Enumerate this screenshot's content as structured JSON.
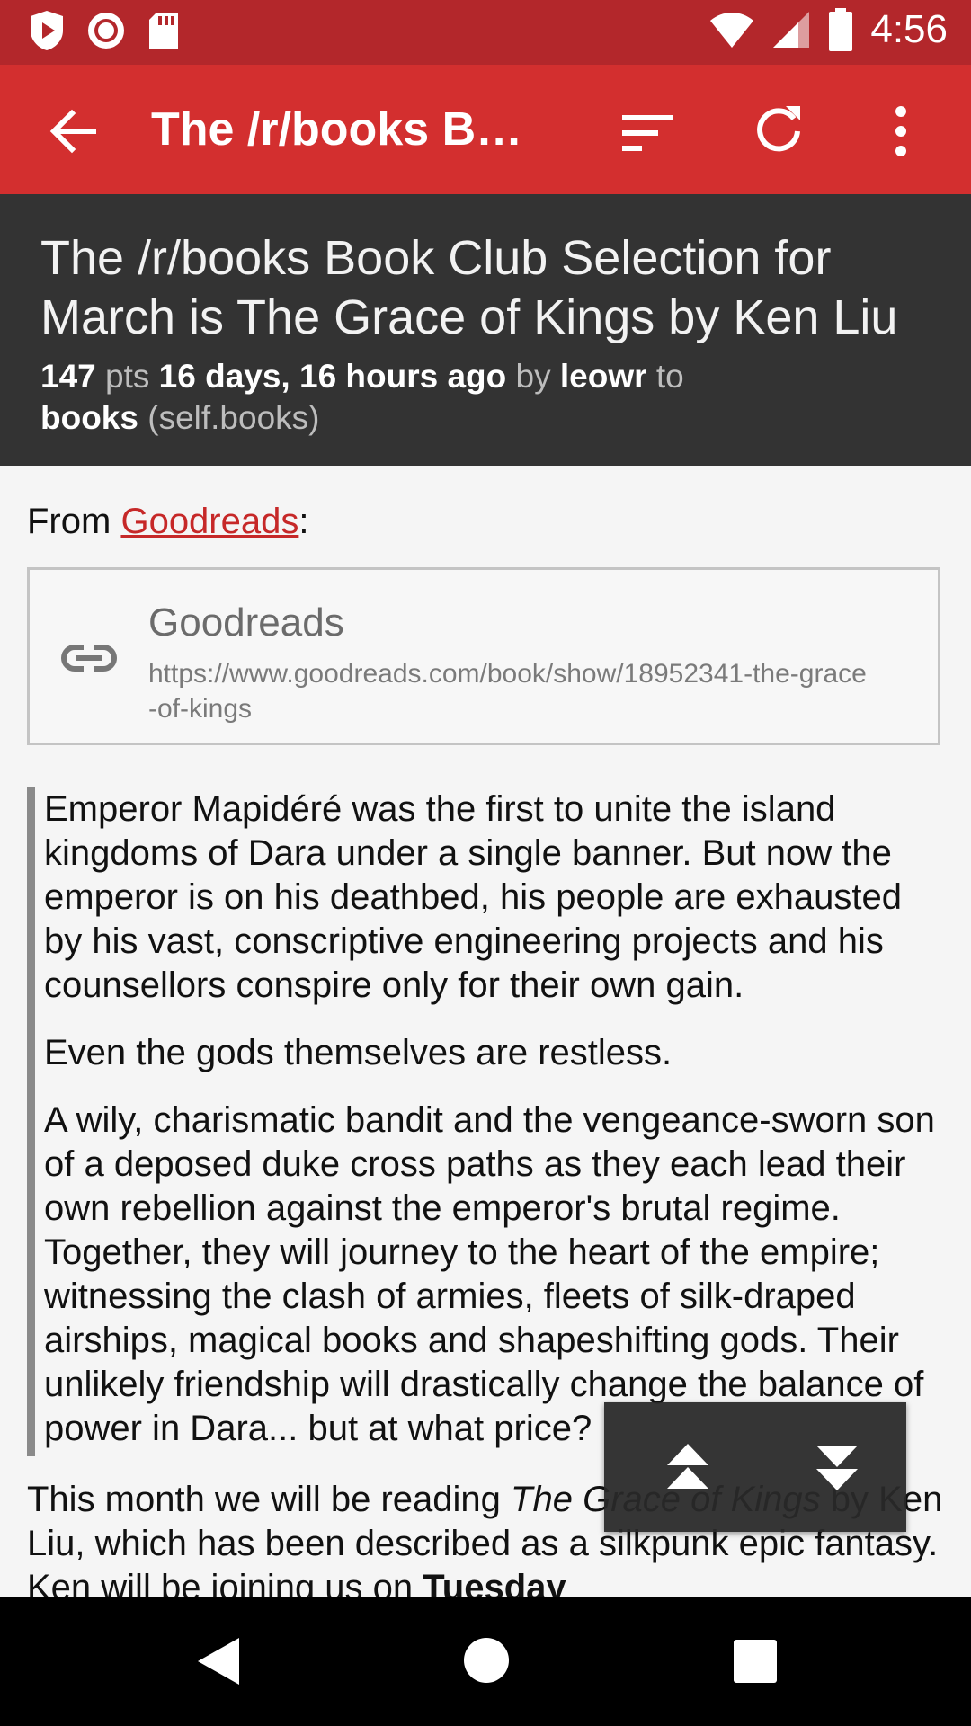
{
  "status_bar": {
    "time": "4:56",
    "left_icons": [
      "play-protect-icon",
      "record-icon",
      "sd-card-icon"
    ],
    "right_icons": [
      "wifi-icon",
      "signal-icon",
      "battery-icon"
    ]
  },
  "toolbar": {
    "title": "The /r/books Bo…",
    "icons": [
      "back-arrow-icon",
      "sort-icon",
      "refresh-icon",
      "more-vert-icon"
    ]
  },
  "post": {
    "title": "The /r/books Book Club Selection for March is The Grace of Kings by Ken Liu",
    "points": "147",
    "pts_label": "pts",
    "age": "16 days, 16 hours ago",
    "by_label": "by",
    "author": "leowr",
    "to_label": "to",
    "subreddit": "books",
    "domain": "(self.books)"
  },
  "body": {
    "from_prefix": "From",
    "from_link": "Goodreads",
    "from_suffix": ":",
    "link_card": {
      "title": "Goodreads",
      "url": "https://www.goodreads.com/book/show/18952341-the-grace-of-kings"
    },
    "quote_paragraphs": [
      "Emperor Mapidéré was the first to unite the island kingdoms of Dara under a single banner. But now the emperor is on his deathbed, his people are exhausted by his vast, conscriptive engineering projects and his counsellors conspire only for their own gain.",
      "Even the gods themselves are restless.",
      "A wily, charismatic bandit and the vengeance-sworn son of a deposed duke cross paths as they each lead their own rebellion against the emperor's brutal regime. Together, they will journey to the heart of the empire; witnessing the clash of armies, fleets of silk-draped airships, magical books and shapeshifting gods. Their unlikely friendship will drastically change the balance of power in Dara... but at what price?"
    ],
    "after_prefix": "This month we will be reading",
    "after_title": "The Grace of Kings",
    "after_middle": "by Ken Liu, which has been described as a silkpunk epic fantasy. Ken will be joining us on",
    "after_bold": "Tuesday"
  },
  "colors": {
    "status_bar": "#b3272b",
    "toolbar": "#d32f2f",
    "header_bg": "#333333",
    "link": "#c62828"
  }
}
